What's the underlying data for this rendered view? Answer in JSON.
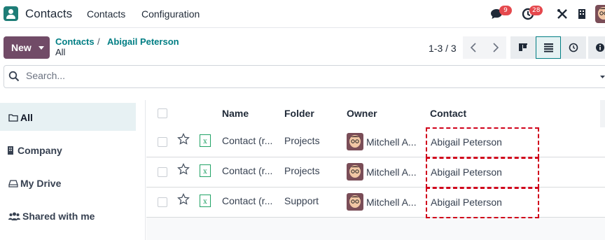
{
  "navbar": {
    "app_name": "Contacts",
    "menu": [
      "Contacts",
      "Configuration"
    ],
    "messages_badge": "9",
    "activities_badge": "28"
  },
  "control": {
    "new_label": "New",
    "breadcrumb_root": "Contacts",
    "breadcrumb_sep": "/",
    "breadcrumb_current": "Abigail Peterson",
    "breadcrumb_sub": "All",
    "pager": "1-3 / 3"
  },
  "search": {
    "placeholder": "Search..."
  },
  "sidebar": {
    "items": [
      {
        "label": "All",
        "icon": "folder-icon"
      },
      {
        "label": "Company",
        "icon": "building-icon"
      },
      {
        "label": "My Drive",
        "icon": "hdd-icon"
      },
      {
        "label": "Shared with me",
        "icon": "users-icon"
      }
    ]
  },
  "table": {
    "columns": [
      "Name",
      "Folder",
      "Owner",
      "Contact"
    ],
    "rows": [
      {
        "name": "Contact (r...",
        "folder": "Projects",
        "owner": "Mitchell A...",
        "contact": "Abigail Peterson"
      },
      {
        "name": "Contact (r...",
        "folder": "Projects",
        "owner": "Mitchell A...",
        "contact": "Abigail Peterson"
      },
      {
        "name": "Contact (r...",
        "folder": "Support",
        "owner": "Mitchell A...",
        "contact": "Abigail Peterson"
      }
    ]
  },
  "colors": {
    "brand": "#714b67",
    "accent": "#017e84",
    "badge": "#e5484d",
    "highlight_border": "#d0021b"
  }
}
